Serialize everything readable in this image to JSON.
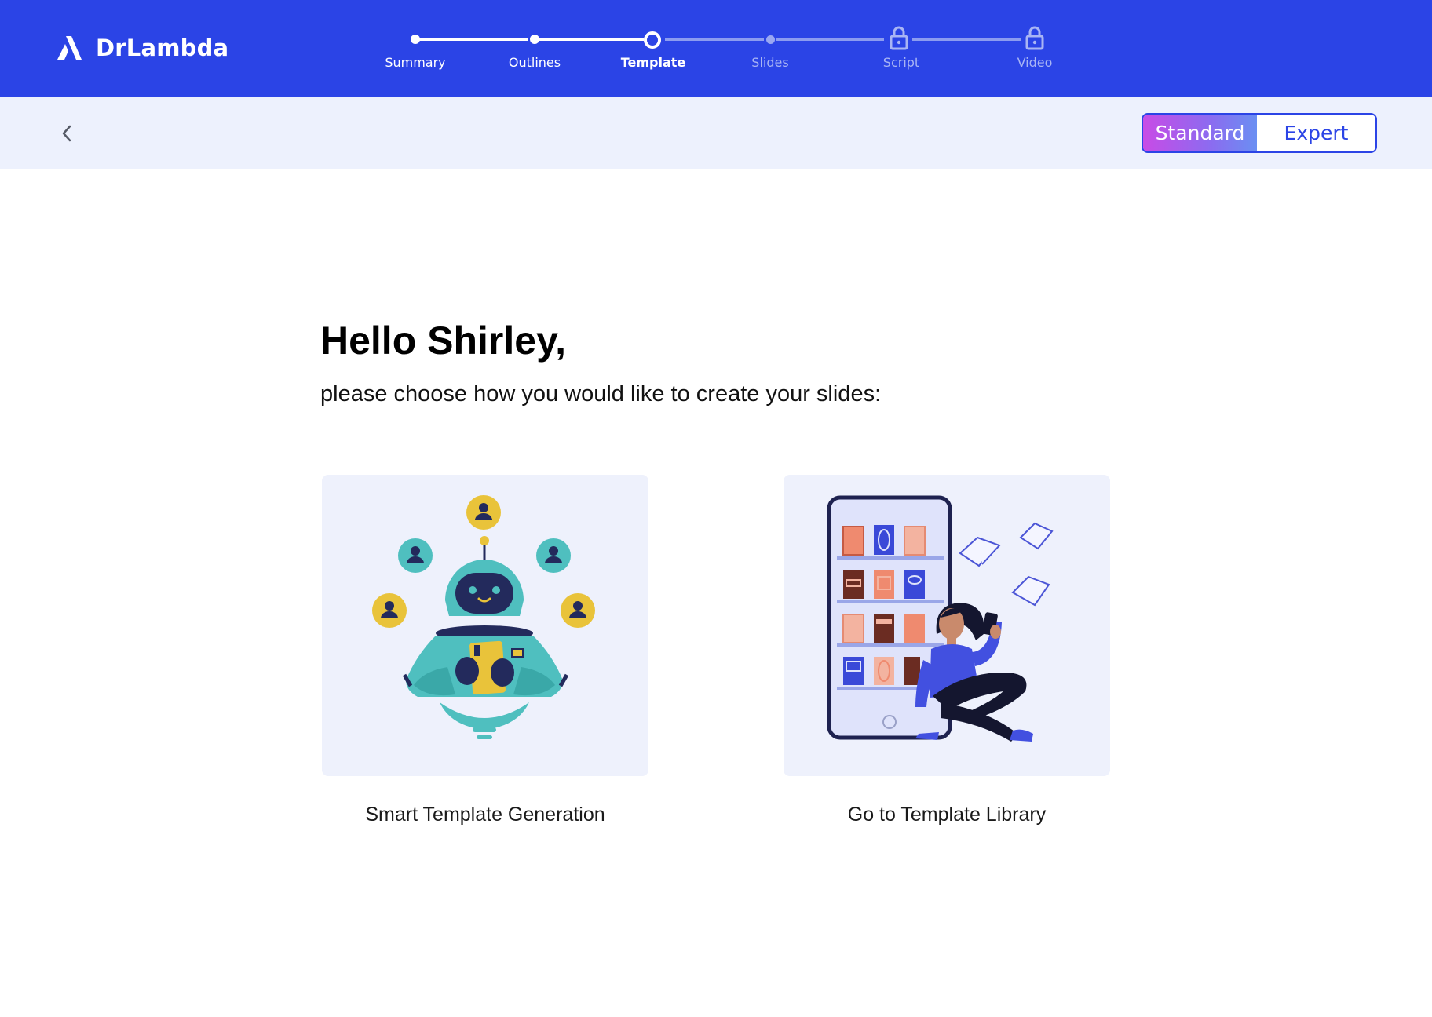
{
  "app": {
    "name": "DrLambda"
  },
  "stepper": {
    "steps": [
      {
        "label": "Summary",
        "state": "done"
      },
      {
        "label": "Outlines",
        "state": "done"
      },
      {
        "label": "Template",
        "state": "current"
      },
      {
        "label": "Slides",
        "state": "pending"
      },
      {
        "label": "Script",
        "state": "locked"
      },
      {
        "label": "Video",
        "state": "locked"
      }
    ]
  },
  "toolbar": {
    "back_icon": "chevron-left-icon",
    "mode_standard": "Standard",
    "mode_expert": "Expert",
    "active_mode": "Standard"
  },
  "main": {
    "greeting": "Hello Shirley,",
    "subtitle": "please choose how you would like to create your slides:",
    "options": [
      {
        "label": "Smart Template Generation",
        "illustration": "robot-illustration"
      },
      {
        "label": "Go to Template Library",
        "illustration": "bookshelf-reader-illustration"
      }
    ]
  },
  "colors": {
    "header_bg": "#2b44e6",
    "subbar_bg": "#edf1fd",
    "card_bg": "#eef1fc",
    "accent": "#2b44e6",
    "gradient_start": "#c84be6",
    "gradient_end": "#6a8ff2"
  }
}
